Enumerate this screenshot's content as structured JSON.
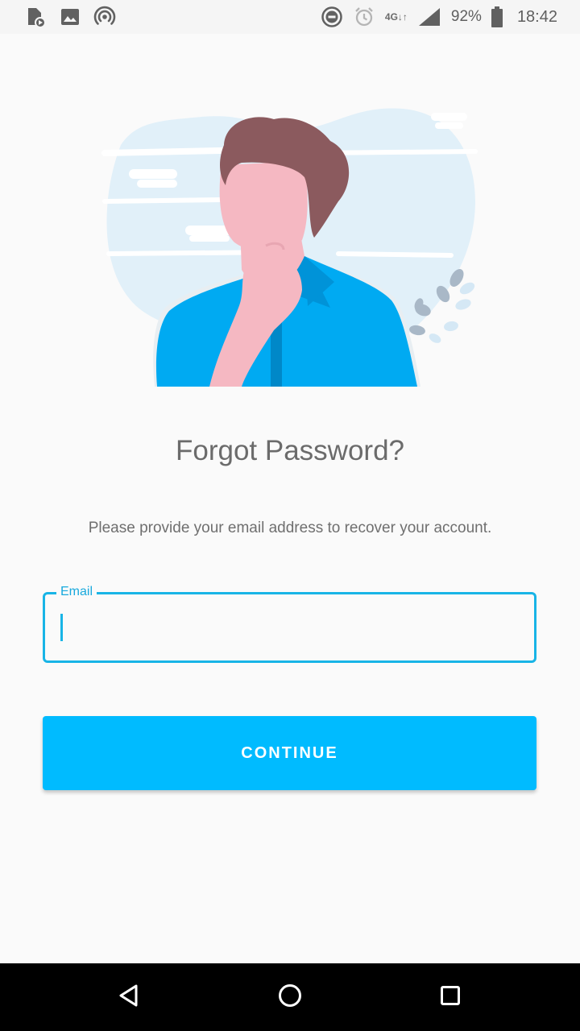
{
  "status_bar": {
    "left_icons": [
      "media-notification-icon",
      "gallery-notification-icon",
      "hotspot-icon"
    ],
    "right_icons": [
      "do-not-disturb-icon",
      "alarm-icon",
      "signal-icon",
      "battery-icon"
    ],
    "network": "4G",
    "battery": "92%",
    "time": "18:42"
  },
  "illustration": {
    "icon": "thinking-person-illustration"
  },
  "title": "Forgot Password?",
  "subtitle": "Please provide your email address to recover your account.",
  "email": {
    "label": "Email",
    "value": "",
    "placeholder": ""
  },
  "continue_button": {
    "label": "CONTINUE"
  },
  "nav_bar": {
    "back": "back-icon",
    "home": "home-icon",
    "recents": "recents-icon"
  },
  "colors": {
    "accent": "#00bbff",
    "field_border": "#18b4e6",
    "text": "#6b6b6b",
    "background": "#fafafa"
  }
}
